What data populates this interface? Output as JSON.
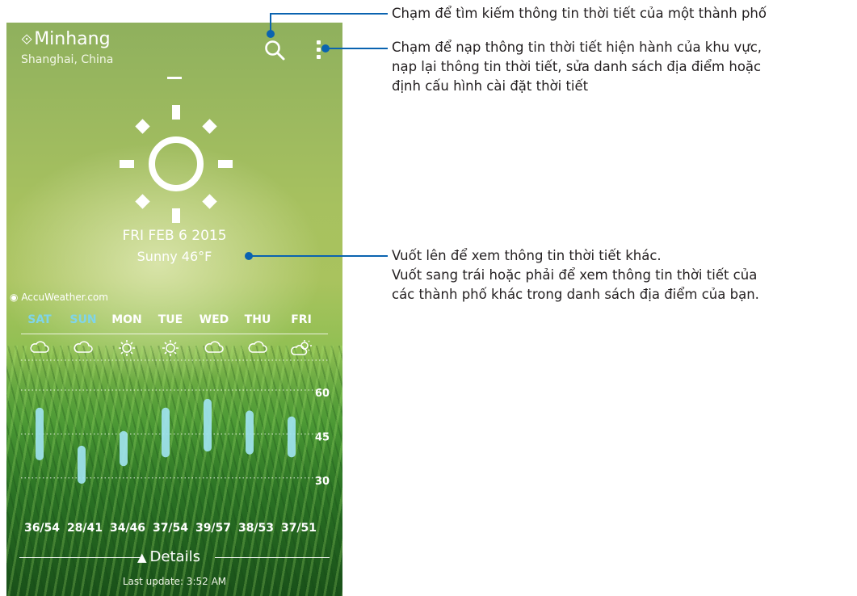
{
  "location": {
    "city": "Minhang",
    "region": "Shanghai, China",
    "pin_icon": "location-pin-icon"
  },
  "toolbar": {
    "search_icon": "search-icon",
    "menu_icon": "more-vert-icon"
  },
  "current": {
    "icon": "sunny-icon",
    "date": "FRI FEB 6 2015",
    "condition": "Sunny 46°F"
  },
  "provider": {
    "label": "AccuWeather.com"
  },
  "forecast": {
    "days": [
      "SAT",
      "SUN",
      "MON",
      "TUE",
      "WED",
      "THU",
      "FRI"
    ],
    "highlighted_days": [
      "SAT",
      "SUN"
    ],
    "icons": [
      "cloudy-icon",
      "cloudy-icon",
      "sunny-icon",
      "sunny-icon",
      "cloudy-icon",
      "cloudy-icon",
      "partly-sunny-icon"
    ],
    "temps": [
      "36/54",
      "28/41",
      "34/46",
      "37/54",
      "39/57",
      "38/53",
      "37/51"
    ]
  },
  "chart_data": {
    "type": "bar",
    "categories": [
      "SAT",
      "SUN",
      "MON",
      "TUE",
      "WED",
      "THU",
      "FRI"
    ],
    "lows": [
      36,
      28,
      34,
      37,
      39,
      38,
      37
    ],
    "highs": [
      54,
      41,
      46,
      54,
      57,
      53,
      51
    ],
    "y_ticks": [
      "60",
      "45",
      "30"
    ],
    "ylim": [
      20,
      60
    ]
  },
  "footer": {
    "details_label": "Details",
    "last_update": "Last update: 3:52 AM"
  },
  "annotations": {
    "search": "Chạm để tìm kiếm thông tin thời tiết của một thành phố",
    "menu": [
      "Chạm để nạp thông tin thời tiết hiện hành của khu vực,",
      "nạp lại thông tin thời tiết, sửa danh sách địa điểm hoặc",
      "định cấu hình cài đặt thời tiết"
    ],
    "swipe": [
      "Vuốt lên để xem thông tin thời tiết khác.",
      "Vuốt sang trái hoặc phải để xem thông tin thời tiết của",
      "các thành phố khác trong danh sách địa điểm của bạn."
    ]
  },
  "colors": {
    "accent_day": "#7fd4ea",
    "bar": "#9fe3ef",
    "callout": "#0a63b0"
  }
}
